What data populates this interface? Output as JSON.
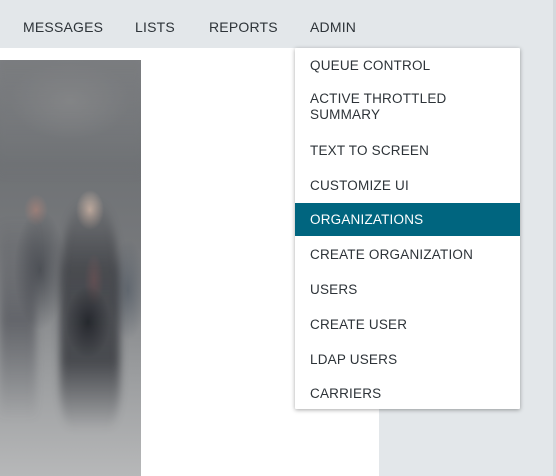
{
  "nav": {
    "items": [
      {
        "label": "MESSAGES"
      },
      {
        "label": "LISTS"
      },
      {
        "label": "REPORTS"
      },
      {
        "label": "ADMIN"
      }
    ]
  },
  "admin_menu": {
    "items": [
      {
        "label": "QUEUE CONTROL"
      },
      {
        "label": "ACTIVE THROTTLED SUMMARY"
      },
      {
        "label": "TEXT TO SCREEN"
      },
      {
        "label": "CUSTOMIZE UI"
      },
      {
        "label": "ORGANIZATIONS",
        "active": true
      },
      {
        "label": "CREATE ORGANIZATION"
      },
      {
        "label": "USERS"
      },
      {
        "label": "CREATE USER"
      },
      {
        "label": "LDAP USERS"
      },
      {
        "label": "CARRIERS"
      }
    ]
  },
  "colors": {
    "nav_background": "#e3e7ea",
    "active_item": "#00657f"
  }
}
